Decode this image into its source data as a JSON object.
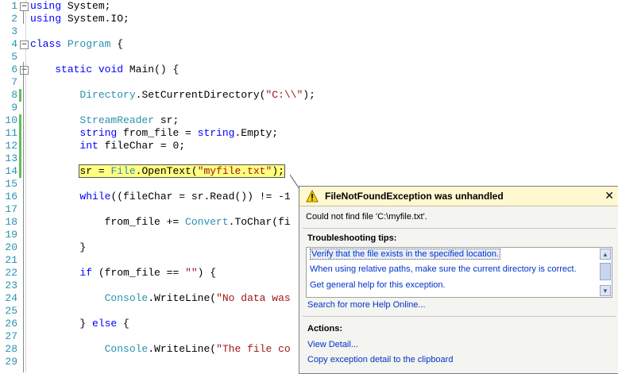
{
  "code_lines": [
    {
      "n": "1",
      "html": "<span class='k'>using</span> System;"
    },
    {
      "n": "2",
      "html": "<span class='k'>using</span> System.IO;"
    },
    {
      "n": "3",
      "html": ""
    },
    {
      "n": "4",
      "html": "<span class='k'>class</span> <span class='t'>Program</span> {"
    },
    {
      "n": "5",
      "html": ""
    },
    {
      "n": "6",
      "html": "    <span class='k'>static</span> <span class='k'>void</span> Main() {"
    },
    {
      "n": "7",
      "html": ""
    },
    {
      "n": "8",
      "html": "        <span class='t'>Directory</span>.SetCurrentDirectory(<span class='s'>\"C:\\\\\"</span>);"
    },
    {
      "n": "9",
      "html": ""
    },
    {
      "n": "10",
      "html": "        <span class='t'>StreamReader</span> sr;"
    },
    {
      "n": "11",
      "html": "        <span class='k'>string</span> from_file = <span class='k'>string</span>.Empty;"
    },
    {
      "n": "12",
      "html": "        <span class='k'>int</span> fileChar = 0;"
    },
    {
      "n": "13",
      "html": ""
    },
    {
      "n": "14",
      "html": "        <span class='hl'>sr = <span class='t'>File</span>.OpenText(<span class='s'>\"myfile.txt\"</span>);</span>"
    },
    {
      "n": "15",
      "html": ""
    },
    {
      "n": "16",
      "html": "        <span class='k'>while</span>((fileChar = sr.Read()) != -1"
    },
    {
      "n": "17",
      "html": ""
    },
    {
      "n": "18",
      "html": "            from_file += <span class='t'>Convert</span>.ToChar(fi"
    },
    {
      "n": "19",
      "html": ""
    },
    {
      "n": "20",
      "html": "        }"
    },
    {
      "n": "21",
      "html": ""
    },
    {
      "n": "22",
      "html": "        <span class='k'>if</span> (from_file == <span class='s'>\"\"</span>) {"
    },
    {
      "n": "23",
      "html": ""
    },
    {
      "n": "24",
      "html": "            <span class='t'>Console</span>.WriteLine(<span class='s'>\"No data was</span>"
    },
    {
      "n": "25",
      "html": ""
    },
    {
      "n": "26",
      "html": "        } <span class='k'>else</span> {"
    },
    {
      "n": "27",
      "html": ""
    },
    {
      "n": "28",
      "html": "            <span class='t'>Console</span>.WriteLine(<span class='s'>\"The file co</span>"
    },
    {
      "n": "29",
      "html": ""
    }
  ],
  "exception": {
    "title": "FileNotFoundException was unhandled",
    "message": "Could not find file 'C:\\myfile.txt'.",
    "tips_header": "Troubleshooting tips:",
    "tips": [
      "Verify that the file exists in the specified location.",
      "When using relative paths, make sure the current directory is correct.",
      "Get general help for this exception."
    ],
    "search_link": "Search for more Help Online...",
    "actions_header": "Actions:",
    "actions": [
      "View Detail...",
      "Copy exception detail to the clipboard"
    ],
    "close_glyph": "✕"
  }
}
